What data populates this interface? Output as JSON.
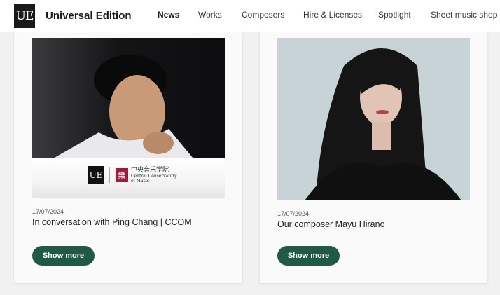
{
  "header": {
    "logo_text": "UE",
    "brand": "Universal Edition",
    "nav": [
      "News",
      "Works",
      "Composers",
      "Hire & Licenses",
      "Spotlight",
      "Sheet music shop"
    ],
    "active": "News"
  },
  "cards": [
    {
      "date": "17/07/2024",
      "title": "In conversation with Ping Chang | CCOM",
      "button": "Show more",
      "image_band": {
        "ue_text": "UE",
        "ccom_chinese": "中央音乐学院",
        "ccom_english": "Central Conservatory of Music"
      }
    },
    {
      "date": "17/07/2024",
      "title": "Our composer Mayu Hirano",
      "button": "Show more"
    }
  ],
  "colors": {
    "accent": "#1f5a47",
    "page_bg": "#f1f1f1",
    "logo_bg": "#1a1a1a"
  }
}
